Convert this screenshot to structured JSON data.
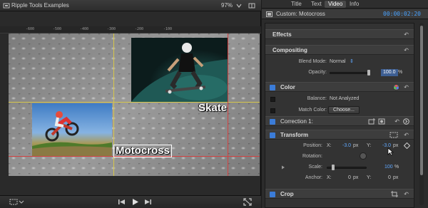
{
  "viewer": {
    "title": "Ripple Tools Examples",
    "zoom": "97%",
    "ruler_labels": [
      "-600",
      "-500",
      "-400",
      "-300",
      "-200",
      "-100"
    ],
    "skate_title": "Skate",
    "moto_title": "Motocross"
  },
  "inspector": {
    "tabs": [
      "Title",
      "Text",
      "Video",
      "Info"
    ],
    "active_tab": "Video",
    "clip_name": "Custom: Motocross",
    "timecode": "00:00:02:20",
    "effects": {
      "label": "Effects"
    },
    "compositing": {
      "label": "Compositing",
      "blend_mode_label": "Blend Mode:",
      "blend_mode_value": "Normal",
      "opacity_label": "Opacity:",
      "opacity_value": "100.0",
      "opacity_unit": "%"
    },
    "color": {
      "label": "Color",
      "balance_label": "Balance:",
      "balance_value": "Not Analyzed",
      "match_label": "Match Color:",
      "choose_label": "Choose..."
    },
    "correction": {
      "label": "Correction 1:"
    },
    "transform": {
      "label": "Transform",
      "position_label": "Position:",
      "x_label": "X:",
      "y_label": "Y:",
      "pos_x": "-3.0",
      "pos_y": "-3.0",
      "px": "px",
      "rotation_label": "Rotation:",
      "scale_label": "Scale:",
      "scale_value": "100",
      "scale_unit": "%",
      "anchor_label": "Anchor:",
      "anchor_x": "0",
      "anchor_y": "0"
    },
    "crop": {
      "label": "Crop"
    }
  },
  "colors": {
    "accent_blue": "#3b7cd8",
    "timecode_blue": "#4aa3ff",
    "guide_yellow": "#d6c64a",
    "guide_red": "#d34242"
  }
}
